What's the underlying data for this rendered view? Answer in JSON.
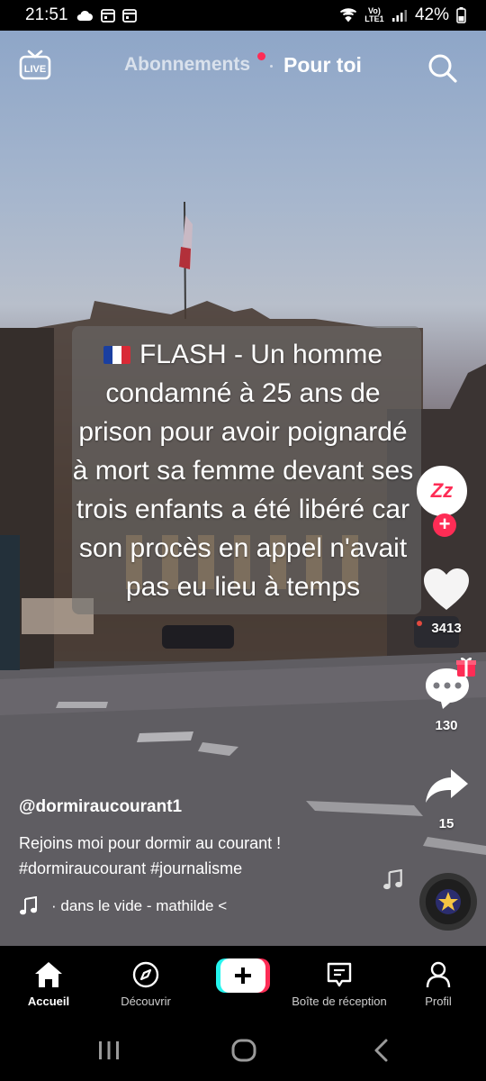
{
  "status_bar": {
    "time": "21:51",
    "network": "Vo) LTE1",
    "battery": "42%"
  },
  "top_nav": {
    "live_label": "LIVE",
    "tab_following": "Abonnements",
    "tab_for_you": "Pour toi"
  },
  "video": {
    "caption_lines": [
      "FLASH - Un homme",
      "condamné à 25 ans de",
      "prison pour avoir poignardé",
      "à mort sa femme devant ses",
      "trois enfants a été libéré car",
      "son procès en appel n'avait",
      "pas eu lieu à temps"
    ]
  },
  "actions": {
    "likes": "3413",
    "comments": "130",
    "shares": "15",
    "avatar_text": "Zz"
  },
  "post": {
    "username": "@dormiraucourant1",
    "description": "Rejoins moi pour dormir au courant !",
    "hashtags": "#dormiraucourant #journalisme",
    "music": "· dans le vide - mathilde <"
  },
  "tabbar": {
    "home": "Accueil",
    "discover": "Découvrir",
    "inbox": "Boîte de réception",
    "profile": "Profil"
  },
  "colors": {
    "accent": "#fe2c55",
    "cyan": "#25f4ee",
    "background": "#000000"
  }
}
